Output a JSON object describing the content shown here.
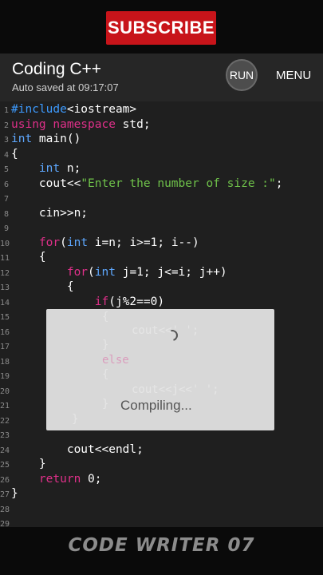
{
  "banner": {
    "subscribe_label": "SUBSCRIBE"
  },
  "appbar": {
    "title": "Coding C++",
    "autosave": "Auto saved at 09:17:07",
    "run_label": "RUN",
    "menu_label": "MENU"
  },
  "code_lines": [
    {
      "n": "1",
      "segs": [
        {
          "t": "#include",
          "c": "kw-dir"
        },
        {
          "t": "<iostream>",
          "c": ""
        }
      ]
    },
    {
      "n": "2",
      "segs": [
        {
          "t": "using namespace",
          "c": "kw-pink"
        },
        {
          "t": " std;",
          "c": ""
        }
      ]
    },
    {
      "n": "3",
      "segs": [
        {
          "t": "int",
          "c": "kw-blue"
        },
        {
          "t": " main()",
          "c": ""
        }
      ]
    },
    {
      "n": "4",
      "segs": [
        {
          "t": "{",
          "c": ""
        }
      ]
    },
    {
      "n": "5",
      "segs": [
        {
          "t": "    ",
          "c": ""
        },
        {
          "t": "int",
          "c": "kw-blue"
        },
        {
          "t": " n;",
          "c": ""
        }
      ]
    },
    {
      "n": "6",
      "segs": [
        {
          "t": "    cout<<",
          "c": ""
        },
        {
          "t": "\"Enter the number of size :\"",
          "c": "str"
        },
        {
          "t": ";",
          "c": ""
        }
      ]
    },
    {
      "n": "7",
      "segs": []
    },
    {
      "n": "8",
      "segs": [
        {
          "t": "    cin>>n;",
          "c": ""
        }
      ]
    },
    {
      "n": "9",
      "segs": []
    },
    {
      "n": "10",
      "segs": [
        {
          "t": "    ",
          "c": ""
        },
        {
          "t": "for",
          "c": "kw-pink"
        },
        {
          "t": "(",
          "c": ""
        },
        {
          "t": "int",
          "c": "kw-blue"
        },
        {
          "t": " i=n; i>=1; i--)",
          "c": ""
        }
      ]
    },
    {
      "n": "11",
      "segs": [
        {
          "t": "    {",
          "c": ""
        }
      ]
    },
    {
      "n": "12",
      "segs": [
        {
          "t": "        ",
          "c": ""
        },
        {
          "t": "for",
          "c": "kw-pink"
        },
        {
          "t": "(",
          "c": ""
        },
        {
          "t": "int",
          "c": "kw-blue"
        },
        {
          "t": " j=1; j<=i; j++)",
          "c": ""
        }
      ]
    },
    {
      "n": "13",
      "segs": [
        {
          "t": "        {",
          "c": ""
        }
      ]
    },
    {
      "n": "14",
      "segs": [
        {
          "t": "            ",
          "c": ""
        },
        {
          "t": "if",
          "c": "kw-pink"
        },
        {
          "t": "(j%2==0)",
          "c": ""
        }
      ]
    },
    {
      "n": "15",
      "segs": []
    },
    {
      "n": "16",
      "segs": []
    },
    {
      "n": "17",
      "segs": []
    },
    {
      "n": "18",
      "segs": []
    },
    {
      "n": "19",
      "segs": []
    },
    {
      "n": "20",
      "segs": []
    },
    {
      "n": "21",
      "segs": []
    },
    {
      "n": "22",
      "segs": []
    },
    {
      "n": "23",
      "segs": []
    },
    {
      "n": "24",
      "segs": [
        {
          "t": "        cout<<endl;",
          "c": ""
        }
      ]
    },
    {
      "n": "25",
      "segs": [
        {
          "t": "    }",
          "c": ""
        }
      ]
    },
    {
      "n": "26",
      "segs": [
        {
          "t": "    ",
          "c": ""
        },
        {
          "t": "return",
          "c": "kw-pink"
        },
        {
          "t": " 0;",
          "c": ""
        }
      ]
    },
    {
      "n": "27",
      "segs": [
        {
          "t": "}",
          "c": ""
        }
      ]
    },
    {
      "n": "28",
      "segs": []
    },
    {
      "n": "29",
      "segs": []
    }
  ],
  "ghost_code": {
    "brace_open_1": "{",
    "cout_a": "cout<<' ';",
    "brace_close_1": "}",
    "else_kw": "else",
    "brace_open_2": "{",
    "cout_b": "cout<<j<<' ';",
    "brace_close_2": "}",
    "brace_close_3": "}"
  },
  "dialog": {
    "message": "Compiling..."
  },
  "footer": {
    "watermark": "CODE WRITER 07"
  }
}
